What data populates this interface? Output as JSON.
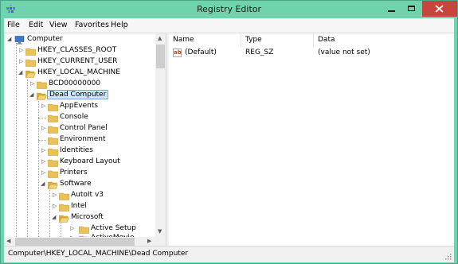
{
  "window": {
    "title": "Registry Editor"
  },
  "menu": [
    "File",
    "Edit",
    "View",
    "Favorites",
    "Help"
  ],
  "tree": {
    "items": [
      {
        "label": "Computer"
      },
      {
        "label": "HKEY_CLASSES_ROOT"
      },
      {
        "label": "HKEY_CURRENT_USER"
      },
      {
        "label": "HKEY_LOCAL_MACHINE"
      },
      {
        "label": "BCD00000000"
      },
      {
        "label": "Dead Computer"
      },
      {
        "label": "AppEvents"
      },
      {
        "label": "Console"
      },
      {
        "label": "Control Panel"
      },
      {
        "label": "Environment"
      },
      {
        "label": "Identities"
      },
      {
        "label": "Keyboard Layout"
      },
      {
        "label": "Printers"
      },
      {
        "label": "Software"
      },
      {
        "label": "AutoIt v3"
      },
      {
        "label": "Intel"
      },
      {
        "label": "Microsoft"
      },
      {
        "label": "Active Setup"
      },
      {
        "label": "ActiveMovie"
      }
    ]
  },
  "list": {
    "columns": [
      "Name",
      "Type",
      "Data"
    ],
    "rows": [
      {
        "name": "(Default)",
        "type": "REG_SZ",
        "data": "(value not set)",
        "icon": "string-value-icon"
      }
    ]
  },
  "statusbar": {
    "path": "Computer\\HKEY_LOCAL_MACHINE\\Dead Computer"
  },
  "colors": {
    "titlebar": "#6fd4ac",
    "close": "#c7453e",
    "folder": "#e8c15a",
    "selection": "#cde8ff"
  }
}
